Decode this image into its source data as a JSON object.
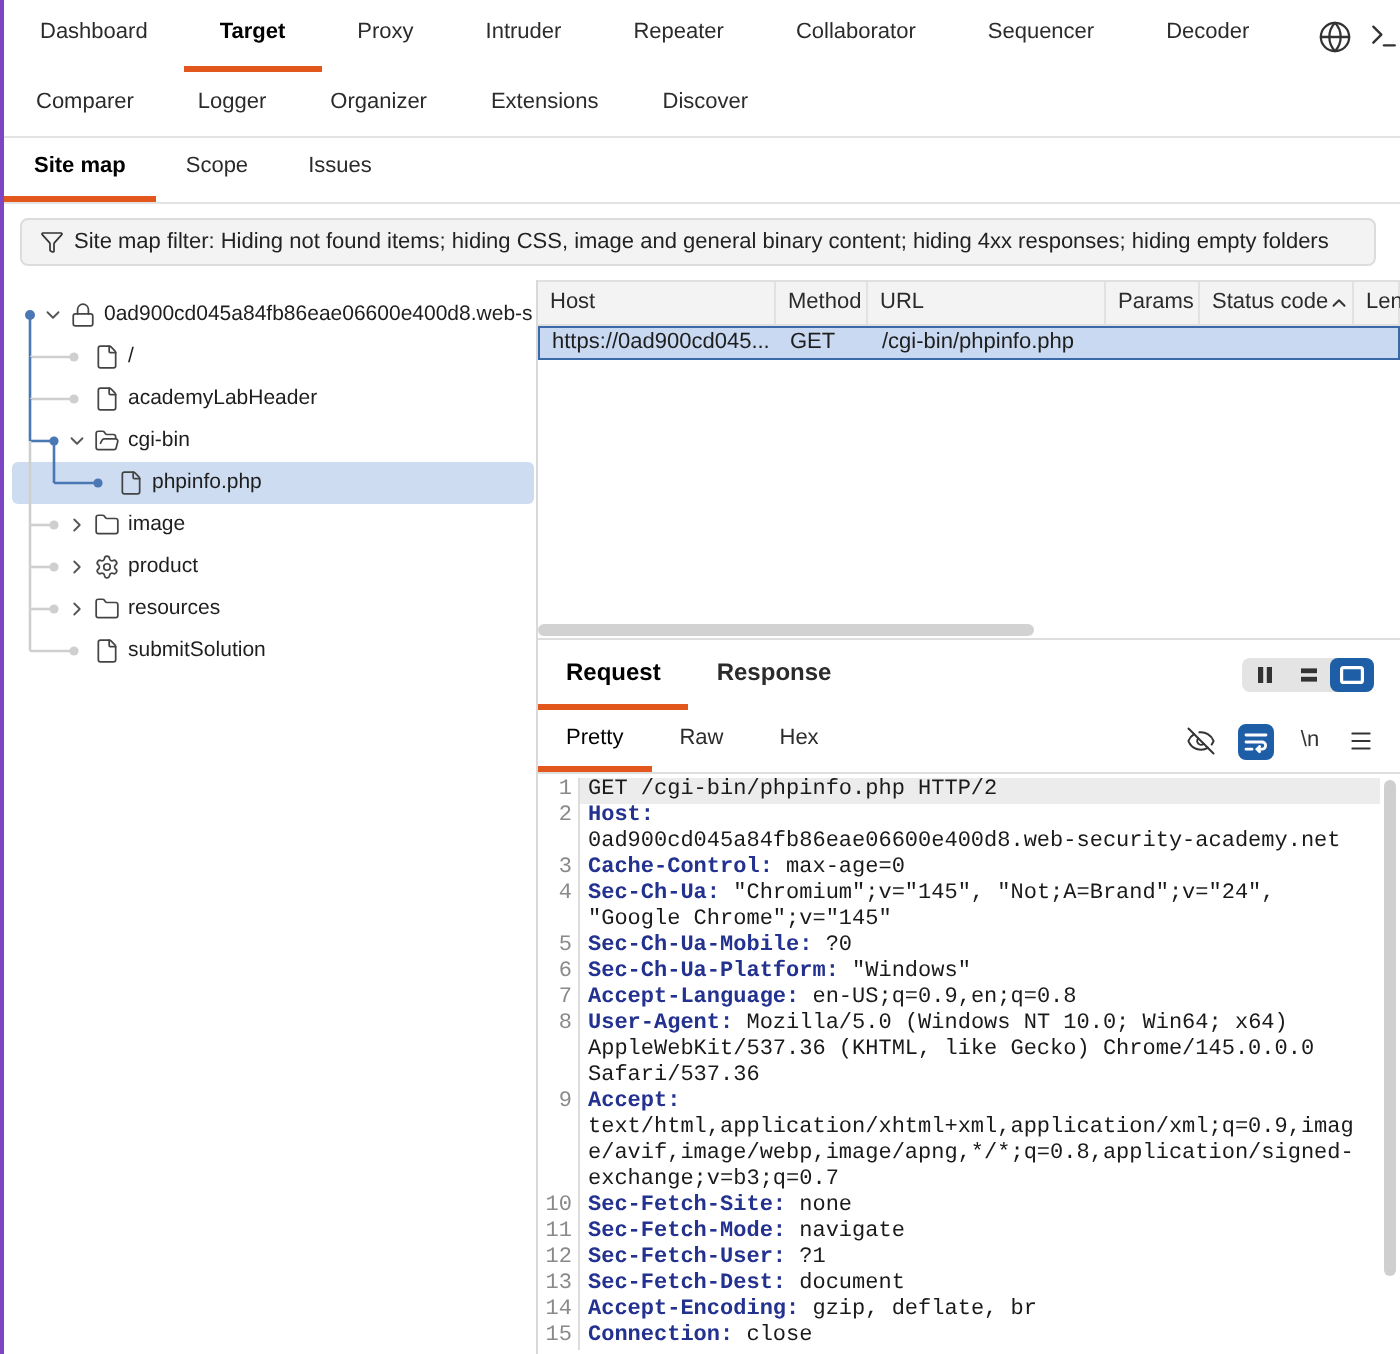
{
  "tool_tab_rows": [
    {
      "tabs": [
        {
          "label": "Dashboard",
          "selected": false
        },
        {
          "label": "Target",
          "selected": true
        },
        {
          "label": "Proxy",
          "selected": false
        },
        {
          "label": "Intruder",
          "selected": false
        },
        {
          "label": "Repeater",
          "selected": false
        },
        {
          "label": "Collaborator",
          "selected": false
        },
        {
          "label": "Sequencer",
          "selected": false
        },
        {
          "label": "Decoder",
          "selected": false
        }
      ]
    },
    {
      "tabs": [
        {
          "label": "Comparer",
          "selected": false
        },
        {
          "label": "Logger",
          "selected": false
        },
        {
          "label": "Organizer",
          "selected": false
        },
        {
          "label": "Extensions",
          "selected": false
        },
        {
          "label": "Discover",
          "selected": false
        }
      ]
    }
  ],
  "target_tabs": [
    {
      "label": "Site map",
      "selected": true
    },
    {
      "label": "Scope",
      "selected": false
    },
    {
      "label": "Issues",
      "selected": false
    }
  ],
  "filter_bar": {
    "text": "Site map filter: Hiding not found items; hiding CSS, image and general binary content; hiding 4xx responses; hiding empty folders"
  },
  "site_tree": {
    "label": "0ad900cd045a84fb86eae06600e400d8.web-s",
    "kind": "host",
    "expanded": true,
    "selected": false,
    "children": [
      {
        "label": "/",
        "kind": "file",
        "selected": false
      },
      {
        "label": "academyLabHeader",
        "kind": "file",
        "selected": false
      },
      {
        "label": "cgi-bin",
        "kind": "folder",
        "expanded": true,
        "selected": false,
        "children": [
          {
            "label": "phpinfo.php",
            "kind": "file",
            "selected": true
          }
        ]
      },
      {
        "label": "image",
        "kind": "folder",
        "expanded": false,
        "selected": false
      },
      {
        "label": "product",
        "kind": "dynamic",
        "expanded": false,
        "selected": false
      },
      {
        "label": "resources",
        "kind": "folder",
        "expanded": false,
        "selected": false
      },
      {
        "label": "submitSolution",
        "kind": "file",
        "selected": false
      }
    ]
  },
  "table": {
    "columns": [
      {
        "label": "Host",
        "sorted": false
      },
      {
        "label": "Method",
        "sorted": false
      },
      {
        "label": "URL",
        "sorted": false
      },
      {
        "label": "Params",
        "sorted": false
      },
      {
        "label": "Status code",
        "sorted": true
      },
      {
        "label": "Len",
        "sorted": false
      }
    ],
    "rows": [
      {
        "cells": [
          "https://0ad900cd045...",
          "GET",
          "/cgi-bin/phpinfo.php"
        ],
        "selected": true
      }
    ]
  },
  "message_tabs": [
    {
      "label": "Request",
      "selected": true
    },
    {
      "label": "Response",
      "selected": false
    }
  ],
  "layout_buttons": [
    {
      "kind": "columns",
      "selected": false
    },
    {
      "kind": "rows",
      "selected": false
    },
    {
      "kind": "single",
      "selected": true
    }
  ],
  "view_tabs": [
    {
      "label": "Pretty",
      "selected": true
    },
    {
      "label": "Raw",
      "selected": false
    },
    {
      "label": "Hex",
      "selected": false
    }
  ],
  "editor_toggles": [
    {
      "kind": "nonprintable",
      "on": false
    },
    {
      "kind": "wrap",
      "on": true
    },
    {
      "kind": "newline",
      "label": "\\n",
      "on": false
    }
  ],
  "request_lines": [
    {
      "number": "1",
      "value": "GET /cgi-bin/phpinfo.php HTTP/2",
      "current": true
    },
    {
      "number": "2",
      "name": "Host:",
      "value": "0ad900cd045a84fb86eae06600e400d8.web-security-academy.net",
      "current": false
    },
    {
      "number": "3",
      "name": "Cache-Control:",
      "value": "max-age=0",
      "current": false
    },
    {
      "number": "4",
      "name": "Sec-Ch-Ua:",
      "value": "\"Chromium\";v=\"145\", \"Not;A=Brand\";v=\"24\", \"Google Chrome\";v=\"145\"",
      "current": false
    },
    {
      "number": "5",
      "name": "Sec-Ch-Ua-Mobile:",
      "value": "?0",
      "current": false
    },
    {
      "number": "6",
      "name": "Sec-Ch-Ua-Platform:",
      "value": "\"Windows\"",
      "current": false
    },
    {
      "number": "7",
      "name": "Accept-Language:",
      "value": "en-US;q=0.9,en;q=0.8",
      "current": false
    },
    {
      "number": "8",
      "name": "User-Agent:",
      "value": "Mozilla/5.0 (Windows NT 10.0; Win64; x64) AppleWebKit/537.36 (KHTML, like Gecko) Chrome/145.0.0.0 Safari/537.36",
      "current": false
    },
    {
      "number": "9",
      "name": "Accept:",
      "value": "text/html,application/xhtml+xml,application/xml;q=0.9,image/avif,image/webp,image/apng,*/*;q=0.8,application/signed-exchange;v=b3;q=0.7",
      "current": false
    },
    {
      "number": "10",
      "name": "Sec-Fetch-Site:",
      "value": "none",
      "current": false
    },
    {
      "number": "11",
      "name": "Sec-Fetch-Mode:",
      "value": "navigate",
      "current": false
    },
    {
      "number": "12",
      "name": "Sec-Fetch-User:",
      "value": "?1",
      "current": false
    },
    {
      "number": "13",
      "name": "Sec-Fetch-Dest:",
      "value": "document",
      "current": false
    },
    {
      "number": "14",
      "name": "Accept-Encoding:",
      "value": "gzip, deflate, br",
      "current": false
    },
    {
      "number": "15",
      "name": "Connection:",
      "value": "close",
      "current": false
    }
  ]
}
